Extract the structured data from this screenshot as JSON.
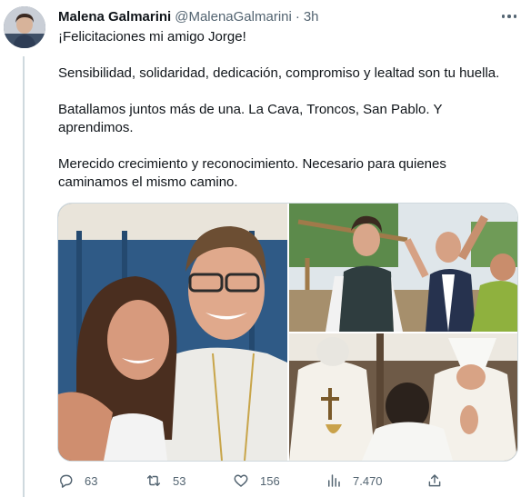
{
  "tweet": {
    "author": {
      "display_name": "Malena Galmarini",
      "handle": "@MalenaGalmarini",
      "separator": "·",
      "time": "3h"
    },
    "text": {
      "line1": "¡Felicitaciones mi amigo Jorge!",
      "line2": "Sensibilidad, solidaridad, dedicación, compromiso y lealtad son tu huella.",
      "line3": "Batallamos juntos más de una. La Cava, Troncos, San Pablo. Y aprendimos.",
      "line4": "Merecido crecimiento y reconocimiento. Necesario para quienes caminamos el mismo camino."
    },
    "stats": {
      "replies": "63",
      "retweets": "53",
      "likes": "156",
      "views": "7.470"
    },
    "icons": {
      "more": "more-horizontal-icon",
      "reply": "reply-icon",
      "retweet": "retweet-icon",
      "like": "heart-icon",
      "views": "views-chart-icon",
      "share": "share-icon"
    },
    "colors": {
      "text": "#0f1419",
      "secondary": "#536471",
      "border": "#cfd9de"
    }
  }
}
